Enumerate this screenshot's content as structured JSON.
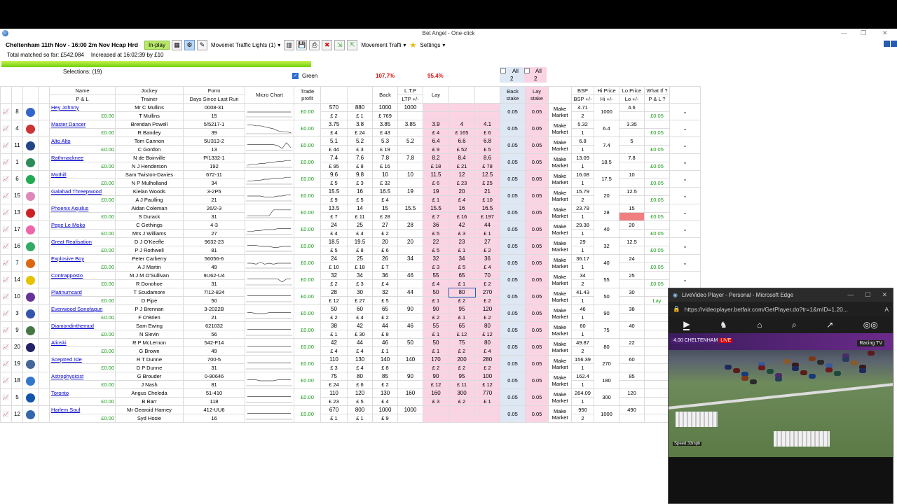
{
  "window": {
    "title": "Bet Angel - One-click"
  },
  "toolbar": {
    "market": "Cheltenham 11th Nov - 16:00 2m Nov Hcap Hrd",
    "status": "In-play",
    "dropdown1": "Movemet Traffic Lights (1)",
    "dropdown2": "Movement Traffi",
    "settings": "Settings"
  },
  "stats": {
    "total": "Total matched so far: £542,084",
    "increased": "Increased at 16:02:39 by £10",
    "selections": "Selections: (19)"
  },
  "header": {
    "green_label": "Green",
    "back_pct": "107.7%",
    "lay_pct": "95.4%",
    "all_back": "All",
    "all_back_n": "2",
    "all_lay": "All",
    "all_lay_n": "2"
  },
  "columns": {
    "name": "Name",
    "pl": "P & L",
    "jockey": "Jockey",
    "trainer": "Trainer",
    "form": "Form",
    "dslr": "Days Since Last Run",
    "micro": "Micro Chart",
    "trade": "Trade profit",
    "back": "Back",
    "ltp": "L.T.P",
    "ltp2": "LTP +/-",
    "lay": "Lay",
    "back_stake": "Back stake",
    "lay_stake": "Lay stake",
    "bsp": "BSP",
    "bsp2": "BSP +/-",
    "hi": "Hi Price",
    "hi2": "Hi +/-",
    "lo": "Lo Price",
    "lo2": "Lo +/-",
    "whatif": "What If ?",
    "whatif2": "P & L ?"
  },
  "colors": {
    "accent_green": "#1a9b1a",
    "pink": "#fbd4e4",
    "blue": "#dde8f4",
    "inplay": "#b7e86a"
  },
  "runners": [
    {
      "no": "8",
      "name": "Hey Johnny",
      "pl": "£0.00",
      "jockey": "Mr C Mullins",
      "trainer": "T Mullins",
      "form": "0008-31",
      "days": "15",
      "trade": "£0.00",
      "b3": "570",
      "b3s": "£ 2",
      "b2": "880",
      "b2s": "£ 1",
      "b1": "1000",
      "b1s": "£ 769",
      "ltp": "1000",
      "ltps": "",
      "l1": "",
      "l1s": "",
      "l2": "",
      "l2s": "",
      "l3": "",
      "l3s": "",
      "bstake": "0.05",
      "lstake": "0.05",
      "mm": "Make Market",
      "bsp": "4.71",
      "bspd": "2",
      "hi": "1000",
      "lo": "4.6",
      "wi": "£0.05",
      "silk": "#3366cc",
      "spark": [
        5,
        5,
        5,
        5,
        5,
        5,
        5,
        5,
        5,
        5,
        5
      ]
    },
    {
      "no": "4",
      "name": "Master Dancer",
      "pl": "£0.00",
      "jockey": "Brendan Powell",
      "trainer": "R Bandey",
      "form": "5/5217-1",
      "days": "39",
      "trade": "£0.00",
      "b3": "3.75",
      "b3s": "£ 4",
      "b2": "3.8",
      "b2s": "£ 24",
      "b1": "3.85",
      "b1s": "£ 43",
      "ltp": "3.85",
      "ltps": "",
      "l1": "3.9",
      "l1s": "£ 4",
      "l2": "4",
      "l2s": "£ 165",
      "l3": "4.1",
      "l3s": "£ 6",
      "bstake": "0.05",
      "lstake": "0.05",
      "mm": "Make Market",
      "bsp": "5.32",
      "bspd": "1",
      "hi": "6.4",
      "lo": "3.35",
      "wi": "£0.05",
      "silk": "#cc3333",
      "spark": [
        9,
        9,
        8,
        8,
        7,
        6,
        5,
        3,
        2,
        2,
        1
      ]
    },
    {
      "no": "11",
      "name": "Alto Alto",
      "pl": "£0.00",
      "jockey": "Tom Cannon",
      "trainer": "C Gordon",
      "form": "5U313-2",
      "days": "13",
      "trade": "£0.00",
      "b3": "5.1",
      "b3s": "£ 44",
      "b2": "5.2",
      "b2s": "£ 3",
      "b1": "5.3",
      "b1s": "£ 19",
      "ltp": "5.2",
      "ltps": "",
      "l1": "6.4",
      "l1s": "£ 9",
      "l2": "6.6",
      "l2s": "£ 52",
      "l3": "6.8",
      "l3s": "£ 5",
      "bstake": "0.05",
      "lstake": "0.05",
      "mm": "Make Market",
      "bsp": "6.8",
      "bspd": "1",
      "hi": "7.4",
      "lo": "5",
      "wi": "£0.05",
      "silk": "#224488",
      "spark": [
        6,
        6,
        6,
        6,
        6,
        6,
        6,
        5,
        2,
        8,
        3
      ]
    },
    {
      "no": "1",
      "name": "Rathmacknee",
      "pl": "£0.00",
      "jockey": "N de Boinville",
      "trainer": "N J Henderson",
      "form": "P/1332-1",
      "days": "192",
      "trade": "£0.00",
      "b3": "7.4",
      "b3s": "£ 95",
      "b2": "7.6",
      "b2s": "£ 8",
      "b1": "7.8",
      "b1s": "£ 16",
      "ltp": "7.8",
      "ltps": "",
      "l1": "8.2",
      "l1s": "£ 18",
      "l2": "8.4",
      "l2s": "£ 21",
      "l3": "8.6",
      "l3s": "£ 78",
      "bstake": "0.05",
      "lstake": "0.05",
      "mm": "Make Market",
      "bsp": "13.09",
      "bspd": "1",
      "hi": "18.5",
      "lo": "7.8",
      "wi": "£0.05",
      "silk": "#2e8b57",
      "spark": [
        2,
        3,
        3,
        4,
        4,
        5,
        5,
        6,
        6,
        7,
        7
      ]
    },
    {
      "no": "6",
      "name": "Mothill",
      "pl": "£0.00",
      "jockey": "Sam Twiston-Davies",
      "trainer": "N P Mulholland",
      "form": "672-11",
      "days": "34",
      "trade": "£0.00",
      "b3": "9.6",
      "b3s": "£ 5",
      "b2": "9.8",
      "b2s": "£ 3",
      "b1": "10",
      "b1s": "£ 32",
      "ltp": "10",
      "ltps": "",
      "l1": "11.5",
      "l1s": "£ 6",
      "l2": "12",
      "l2s": "£ 23",
      "l3": "12.5",
      "l3s": "£ 25",
      "bstake": "0.05",
      "lstake": "0.05",
      "mm": "Make Market",
      "bsp": "16.08",
      "bspd": "1",
      "hi": "17.5",
      "lo": "10",
      "wi": "£0.05",
      "silk": "#22aa55",
      "spark": [
        3,
        3,
        4,
        4,
        5,
        5,
        6,
        6,
        6,
        7,
        7
      ]
    },
    {
      "no": "15",
      "name": "Galahad Threepwood",
      "pl": "£0.00",
      "jockey": "Kielan Woods",
      "trainer": "A J Paulling",
      "form": "3-2P5",
      "days": "21",
      "trade": "£0.00",
      "b3": "15.5",
      "b3s": "£ 9",
      "b2": "16",
      "b2s": "£ 5",
      "b1": "16.5",
      "b1s": "£ 4",
      "ltp": "19",
      "ltps": "",
      "l1": "19",
      "l1s": "£ 1",
      "l2": "20",
      "l2s": "£ 4",
      "l3": "21",
      "l3s": "£ 10",
      "bstake": "0.05",
      "lstake": "0.05",
      "mm": "Make Market",
      "bsp": "15.79",
      "bspd": "2",
      "hi": "20",
      "lo": "12.5",
      "wi": "£0.05",
      "silk": "#dd88bb",
      "spark": [
        5,
        5,
        5,
        5,
        4,
        4,
        4,
        5,
        5,
        6,
        6
      ]
    },
    {
      "no": "13",
      "name": "Phoenix Aquilus",
      "pl": "£0.00",
      "jockey": "Aidan Coleman",
      "trainer": "S Durack",
      "form": "26/2-3",
      "days": "31",
      "trade": "£0.00",
      "b3": "13.5",
      "b3s": "£ 7",
      "b2": "14",
      "b2s": "£ 11",
      "b1": "15",
      "b1s": "£ 28",
      "ltp": "15.5",
      "ltps": "",
      "l1": "15.5",
      "l1s": "£ 7",
      "l2": "16",
      "l2s": "£ 16",
      "l3": "16.5",
      "l3s": "£ 197",
      "bstake": "0.05",
      "lstake": "0.05",
      "mm": "Make Market",
      "bsp": "23.78",
      "bspd": "1",
      "hi": "28",
      "lo": "15",
      "wi": "£0.05",
      "silk": "#cc2222",
      "spark": [
        2,
        2,
        2,
        2,
        2,
        2,
        8,
        8,
        8,
        8,
        8
      ]
    },
    {
      "no": "17",
      "name": "Pepe Le Moko",
      "pl": "£0.00",
      "jockey": "C Gethings",
      "trainer": "Mrs J Williams",
      "form": "4-3",
      "days": "27",
      "trade": "£0.00",
      "b3": "24",
      "b3s": "£ 4",
      "b2": "25",
      "b2s": "£ 4",
      "b1": "27",
      "b1s": "£ 2",
      "ltp": "28",
      "ltps": "",
      "l1": "36",
      "l1s": "£ 5",
      "l2": "42",
      "l2s": "£ 3",
      "l3": "44",
      "l3s": "£ 1",
      "bstake": "0.05",
      "lstake": "0.05",
      "mm": "Make Market",
      "bsp": "29.38",
      "bspd": "1",
      "hi": "40",
      "lo": "20",
      "wi": "£0.05",
      "silk": "#ee66aa",
      "spark": [
        3,
        3,
        4,
        4,
        5,
        5,
        5,
        6,
        6,
        6,
        6
      ]
    },
    {
      "no": "16",
      "name": "Great Realisation",
      "pl": "£0.00",
      "jockey": "D J O'Keeffe",
      "trainer": "P J Rothwell",
      "form": "9632-23",
      "days": "81",
      "trade": "£0.00",
      "b3": "18.5",
      "b3s": "£ 5",
      "b2": "19.5",
      "b2s": "£ 8",
      "b1": "20",
      "b1s": "£ 6",
      "ltp": "20",
      "ltps": "",
      "l1": "22",
      "l1s": "£ 5",
      "l2": "23",
      "l2s": "£ 1",
      "l3": "27",
      "l3s": "£ 2",
      "bstake": "0.05",
      "lstake": "0.05",
      "mm": "Make Market",
      "bsp": "29",
      "bspd": "1",
      "hi": "32",
      "lo": "12.5",
      "wi": "£0.05",
      "silk": "#33aa66",
      "spark": [
        6,
        6,
        6,
        5,
        5,
        5,
        4,
        4,
        5,
        5,
        5
      ]
    },
    {
      "no": "7",
      "name": "Explosive Boy",
      "pl": "£0.00",
      "jockey": "Peter Carberry",
      "trainer": "A J Martin",
      "form": "56056-6",
      "days": "49",
      "trade": "£0.00",
      "b3": "24",
      "b3s": "£ 10",
      "b2": "25",
      "b2s": "£ 18",
      "b1": "26",
      "b1s": "£ 7",
      "ltp": "34",
      "ltps": "",
      "l1": "32",
      "l1s": "£ 3",
      "l2": "34",
      "l2s": "£ 5",
      "l3": "36",
      "l3s": "£ 4",
      "bstake": "0.05",
      "lstake": "0.05",
      "mm": "Make Market",
      "bsp": "36.17",
      "bspd": "1",
      "hi": "40",
      "lo": "24",
      "wi": "£0.05",
      "silk": "#dd6611",
      "spark": [
        5,
        5,
        4,
        6,
        4,
        5,
        4,
        5,
        5,
        5,
        5
      ]
    },
    {
      "no": "14",
      "name": "Contrapposto",
      "pl": "£0.00",
      "jockey": "M J M O'Sullivan",
      "trainer": "R Donohoe",
      "form": "9U62-U4",
      "days": "31",
      "trade": "£0.00",
      "b3": "32",
      "b3s": "£ 2",
      "b2": "34",
      "b2s": "£ 3",
      "b1": "36",
      "b1s": "£ 4",
      "ltp": "46",
      "ltps": "",
      "l1": "55",
      "l1s": "£ 4",
      "l2": "65",
      "l2s": "£ 1",
      "l3": "70",
      "l3s": "£ 2",
      "bstake": "0.05",
      "lstake": "0.05",
      "mm": "Make Market",
      "bsp": "34",
      "bspd": "2",
      "hi": "55",
      "lo": "25",
      "wi": "£0.05",
      "silk": "#e6c200",
      "spark": [
        6,
        6,
        6,
        6,
        6,
        6,
        6,
        6,
        3,
        6,
        6
      ]
    },
    {
      "no": "10",
      "name": "Platinumcard",
      "pl": "£0.00",
      "jockey": "T Scudamore",
      "trainer": "D Pipe",
      "form": "7/12-824",
      "days": "50",
      "trade": "£0.00",
      "b3": "28",
      "b3s": "£ 12",
      "b2": "30",
      "b2s": "£ 27",
      "b1": "32",
      "b1s": "£ 5",
      "ltp": "44",
      "ltps": "",
      "l1": "50",
      "l1s": "£ 1",
      "l2": "80",
      "l2s": "£ 2",
      "l3": "270",
      "l3s": "£ 2",
      "bstake": "0.05",
      "lstake": "0.05",
      "mm": "Make Market",
      "bsp": "41.43",
      "bspd": "1",
      "hi": "50",
      "lo": "30",
      "wi": "Lay",
      "silk": "#663399",
      "spark": [
        6,
        6,
        6,
        6,
        6,
        6,
        6,
        6,
        6,
        6,
        6
      ]
    },
    {
      "no": "3",
      "name": "Evenwood Sonofagun",
      "pl": "£0.00",
      "jockey": "P J Brennan",
      "trainer": "F O'Brien",
      "form": "3-2022B",
      "days": "21",
      "trade": "£0.00",
      "b3": "50",
      "b3s": "£ 2",
      "b2": "60",
      "b2s": "£ 4",
      "b1": "65",
      "b1s": "£ 2",
      "ltp": "90",
      "ltps": "",
      "l1": "90",
      "l1s": "£ 2",
      "l2": "95",
      "l2s": "£ 1",
      "l3": "120",
      "l3s": "£ 2",
      "bstake": "0.05",
      "lstake": "0.05",
      "mm": "Make Market",
      "bsp": "46",
      "bspd": "1",
      "hi": "90",
      "lo": "38",
      "wi": "",
      "silk": "#3355aa",
      "spark": [
        6,
        6,
        5,
        5,
        5,
        6,
        6,
        6,
        6,
        6,
        6
      ]
    },
    {
      "no": "9",
      "name": "Diamondinthemud",
      "pl": "£0.00",
      "jockey": "Sam Ewing",
      "trainer": "N Slevin",
      "form": "621032",
      "days": "56",
      "trade": "£0.00",
      "b3": "38",
      "b3s": "£ 1",
      "b2": "42",
      "b2s": "£ 30",
      "b1": "44",
      "b1s": "£ 8",
      "ltp": "46",
      "ltps": "",
      "l1": "55",
      "l1s": "£ 1",
      "l2": "65",
      "l2s": "£ 12",
      "l3": "80",
      "l3s": "£ 12",
      "bstake": "0.05",
      "lstake": "0.05",
      "mm": "Make Market",
      "bsp": "60",
      "bspd": "1",
      "hi": "75",
      "lo": "40",
      "wi": "",
      "silk": "#447744",
      "spark": [
        6,
        6,
        6,
        6,
        6,
        6,
        6,
        6,
        6,
        6,
        6
      ]
    },
    {
      "no": "20",
      "name": "Alioski",
      "pl": "£0.00",
      "jockey": "R P McLernon",
      "trainer": "G Brown",
      "form": "542-F14",
      "days": "49",
      "trade": "£0.00",
      "b3": "42",
      "b3s": "£ 4",
      "b2": "44",
      "b2s": "£ 4",
      "b1": "46",
      "b1s": "£ 1",
      "ltp": "50",
      "ltps": "",
      "l1": "50",
      "l1s": "£ 1",
      "l2": "75",
      "l2s": "£ 2",
      "l3": "80",
      "l3s": "£ 4",
      "bstake": "0.05",
      "lstake": "0.05",
      "mm": "Make Market",
      "bsp": "49.87",
      "bspd": "2",
      "hi": "80",
      "lo": "22",
      "wi": "",
      "silk": "#222266",
      "spark": [
        6,
        6,
        6,
        6,
        6,
        6,
        6,
        6,
        6,
        6,
        6
      ]
    },
    {
      "no": "19",
      "name": "Sceptred Isle",
      "pl": "£0.00",
      "jockey": "R T Dunne",
      "trainer": "D P Dunne",
      "form": "700-5",
      "days": "31",
      "trade": "£0.00",
      "b3": "110",
      "b3s": "£ 3",
      "b2": "130",
      "b2s": "£ 4",
      "b1": "140",
      "b1s": "£ 8",
      "ltp": "140",
      "ltps": "",
      "l1": "170",
      "l1s": "£ 2",
      "l2": "200",
      "l2s": "£ 2",
      "l3": "280",
      "l3s": "£ 2",
      "bstake": "0.05",
      "lstake": "0.05",
      "mm": "Make Market",
      "bsp": "156.39",
      "bspd": "1",
      "hi": "270",
      "lo": "60",
      "wi": "",
      "silk": "#446699",
      "spark": [
        6,
        6,
        6,
        6,
        6,
        6,
        6,
        6,
        6,
        6,
        6
      ]
    },
    {
      "no": "18",
      "name": "Astrophysicist",
      "pl": "£0.00",
      "jockey": "G Brouder",
      "trainer": "J Nash",
      "form": "0-90646",
      "days": "81",
      "trade": "£0.00",
      "b3": "75",
      "b3s": "£ 24",
      "b2": "80",
      "b2s": "£ 6",
      "b1": "85",
      "b1s": "£ 2",
      "ltp": "90",
      "ltps": "",
      "l1": "90",
      "l1s": "£ 12",
      "l2": "95",
      "l2s": "£ 11",
      "l3": "100",
      "l3s": "£ 12",
      "bstake": "0.05",
      "lstake": "0.05",
      "mm": "Make Market",
      "bsp": "162.4",
      "bspd": "1",
      "hi": "180",
      "lo": "85",
      "wi": "",
      "silk": "#3377cc",
      "spark": [
        6,
        6,
        6,
        5,
        5,
        5,
        5,
        6,
        6,
        6,
        6
      ]
    },
    {
      "no": "5",
      "name": "Toronto",
      "pl": "£0.00",
      "jockey": "Angus Cheleda",
      "trainer": "B Barr",
      "form": "51-410",
      "days": "118",
      "trade": "£0.00",
      "b3": "110",
      "b3s": "£ 23",
      "b2": "120",
      "b2s": "£ 5",
      "b1": "130",
      "b1s": "£ 4",
      "ltp": "160",
      "ltps": "",
      "l1": "160",
      "l1s": "£ 3",
      "l2": "300",
      "l2s": "£ 2",
      "l3": "770",
      "l3s": "£ 1",
      "bstake": "0.05",
      "lstake": "0.05",
      "mm": "Make Market",
      "bsp": "264.09",
      "bspd": "1",
      "hi": "300",
      "lo": "120",
      "wi": "",
      "silk": "#1155aa",
      "spark": [
        6,
        6,
        6,
        6,
        6,
        6,
        6,
        6,
        6,
        6,
        6
      ]
    },
    {
      "no": "12",
      "name": "Harlem Soul",
      "pl": "£0.00",
      "jockey": "Mr Gearoid Harney",
      "trainer": "Syd Hosie",
      "form": "412-UU6",
      "days": "16",
      "trade": "£0.00",
      "b3": "670",
      "b3s": "£ 1",
      "b2": "800",
      "b2s": "£ 1",
      "b1": "1000",
      "b1s": "£ 9",
      "ltp": "1000",
      "ltps": "",
      "l1": "",
      "l1s": "",
      "l2": "",
      "l2s": "",
      "l3": "",
      "l3s": "",
      "bstake": "0.05",
      "lstake": "0.05",
      "mm": "Make Market",
      "bsp": "950",
      "bspd": "2",
      "hi": "1000",
      "lo": "490",
      "wi": "",
      "silk": "#3366aa",
      "spark": [
        6,
        6,
        6,
        6,
        6,
        6,
        6,
        6,
        6,
        6,
        6
      ]
    }
  ],
  "video": {
    "title": "LiveVideo Player - Personal - Microsoft Edge",
    "url": "https://videoplayer.betfair.com/GetPlayer.do?tr=1&mID=1.20...",
    "race_label": "4.00 CHELTENHAM",
    "live": "LIVE",
    "channel": "Racing TV",
    "speed": "Speed 33mph"
  }
}
